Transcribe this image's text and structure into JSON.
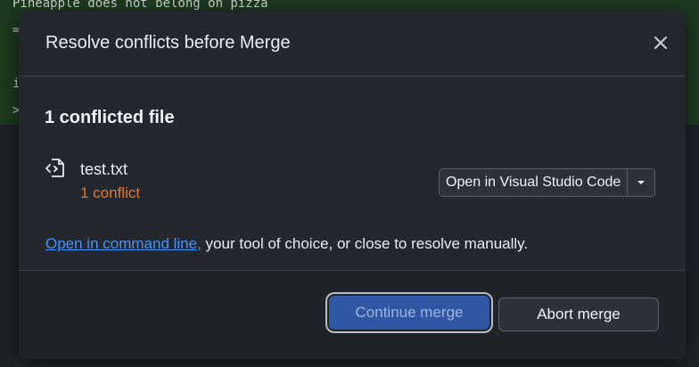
{
  "background": {
    "lines": [
      "Pineapple does not belong on pizza",
      "=",
      "i",
      ">"
    ]
  },
  "dialog": {
    "title": "Resolve conflicts before Merge",
    "section_title": "1 conflicted file",
    "file": {
      "name": "test.txt",
      "conflicts": "1 conflict",
      "icon": "file-code-icon"
    },
    "open_button_label": "Open in Visual Studio Code",
    "command_line_link": "Open in command line,",
    "command_line_rest": " your tool of choice, or close to resolve manually.",
    "continue_label": "Continue merge",
    "abort_label": "Abort merge"
  },
  "colors": {
    "dialog_bg": "#24282e",
    "primary_button": "#2f57a4",
    "conflict_text": "#e8772e",
    "link": "#4493f8"
  }
}
